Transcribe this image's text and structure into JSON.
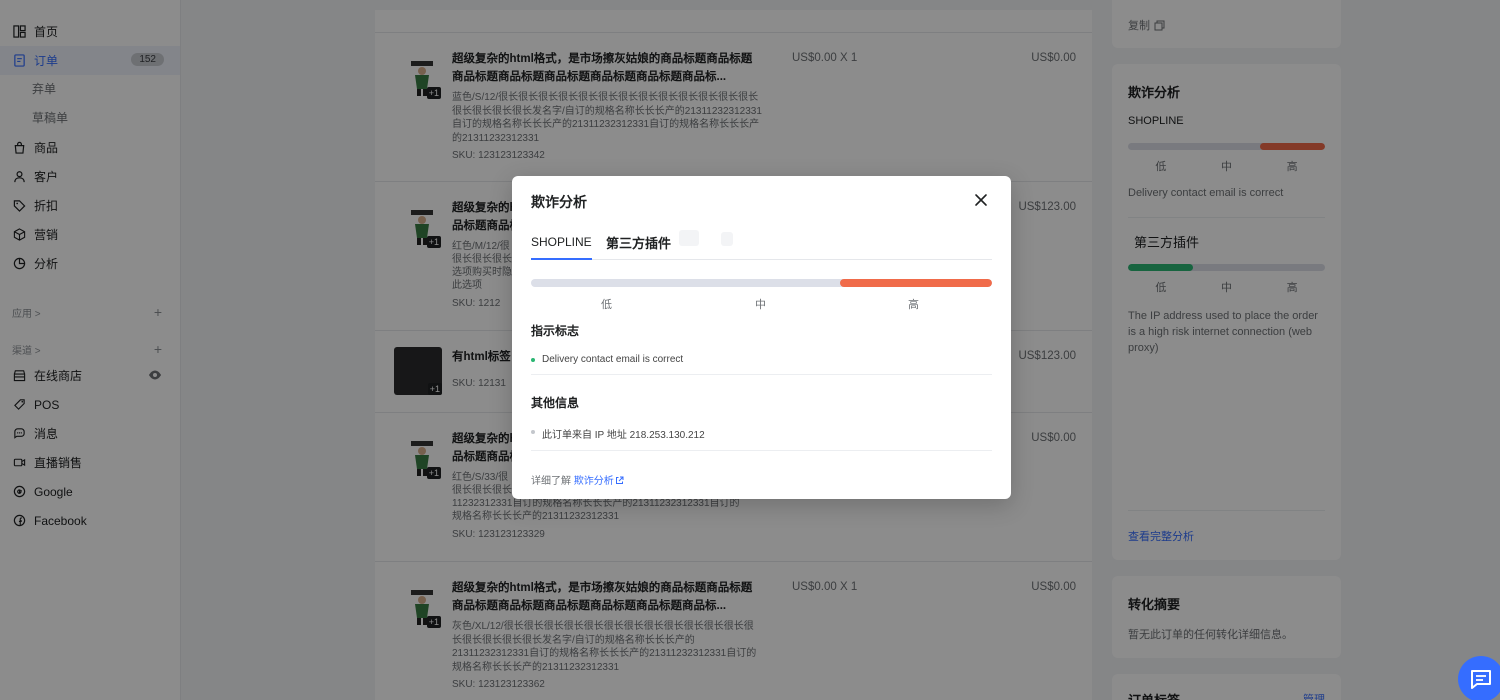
{
  "sidebar": {
    "items": [
      {
        "label": "首页",
        "icon": "home-icon"
      },
      {
        "label": "订单",
        "icon": "order-icon",
        "badge": "152",
        "active": true
      },
      {
        "label": "商品",
        "icon": "bag-icon"
      },
      {
        "label": "客户",
        "icon": "user-icon"
      },
      {
        "label": "折扣",
        "icon": "tag-icon"
      },
      {
        "label": "营销",
        "icon": "cube-icon"
      },
      {
        "label": "分析",
        "icon": "chart-icon"
      }
    ],
    "order_sub": [
      "弃单",
      "草稿单"
    ],
    "apps_section": "应用 >",
    "channels_section": "渠道 >",
    "channels": [
      {
        "label": "在线商店",
        "icon": "store-icon"
      },
      {
        "label": "POS",
        "icon": "pos-icon"
      },
      {
        "label": "消息",
        "icon": "message-icon"
      },
      {
        "label": "直播销售",
        "icon": "live-icon"
      },
      {
        "label": "Google",
        "icon": "google-icon"
      },
      {
        "label": "Facebook",
        "icon": "facebook-icon"
      }
    ],
    "plus": "+"
  },
  "products": [
    {
      "title": "超级复杂的html格式，是市场擦灰姑娘的商品标题商品标题商品标题商品标题商品标题商品标题商品标题商品标...",
      "variant": "蓝色/S/12/很长很长很长很长很长很长很长很长很长很长很长很长很长很长很长很长很长发名字/自订的规格名称长长长产的21311232312331自订的规格名称长长长产的21311232312331自订的规格名称长长长产的21311232312331",
      "sku": "SKU:  123123123342",
      "price": "US$0.00 X 1",
      "total": "US$0.00"
    },
    {
      "title": "超级复杂的h",
      "title2": "品标题商品标",
      "variant": "红色/M/12/很",
      "variant2": "很长很长很长",
      "variant3": "选项购买时隐",
      "variant4": "此选项",
      "sku": "SKU:  1212",
      "total": "US$123.00"
    },
    {
      "title": "有html标签",
      "sku": "SKU:  12131",
      "total": "US$123.00"
    },
    {
      "title": "超级复杂的h",
      "title2": "品标题商品标",
      "variant": "红色/S/33/很",
      "variant2": "很长很长很长",
      "variant3": "11232312331自订的规格名称长长长产的21311232312331自订的",
      "variant4": "规格名称长长长产的21311232312331",
      "sku": "SKU:  123123123329",
      "total": "US$0.00"
    },
    {
      "title": "超级复杂的html格式，是市场擦灰姑娘的商品标题商品标题商品标题商品标题商品标题商品标题商品标题商品标...",
      "variant": "灰色/XL/12/很长很长很长很长很长很长很长很长很长很长很长很长很长很长很长很长很长发名字/自订的规格名称长长长产的21311232312331自订的规格名称长长长产的21311232312331自订的规格名称长长长产的21311232312331",
      "sku": "SKU:  123123123362",
      "price": "US$0.00 X 1",
      "total": "US$0.00"
    }
  ],
  "plus_badge": "+1",
  "right": {
    "copy_label": "复制",
    "fraud": {
      "title": "欺诈分析",
      "shopline_label": "SHOPLINE",
      "shopline_level": 0.67,
      "levels": [
        "低",
        "中",
        "高"
      ],
      "shopline_note": "Delivery contact email is correct",
      "third_label": "第三方插件",
      "third_level": 0.33,
      "third_note": "The IP address used to place the order is a high risk internet connection (web proxy)",
      "link": "查看完整分析"
    },
    "conversion": {
      "title": "转化摘要",
      "text": "暂无此订单的任何转化详细信息。"
    },
    "tags": {
      "title": "订单标签",
      "manage": "管理"
    }
  },
  "modal": {
    "title": "欺诈分析",
    "tabs": [
      "SHOPLINE",
      "第三方插件"
    ],
    "risk_level": 0.67,
    "levels": [
      "低",
      "中",
      "高"
    ],
    "indicators_title": "指示标志",
    "indicator": "Delivery contact email is correct",
    "other_title": "其他信息",
    "other": "此订单来自 IP 地址 218.253.130.212",
    "footer_prefix": "详细了解 ",
    "footer_link": "欺诈分析",
    "colors": {
      "accent": "#356dff",
      "high": "#f06b4a",
      "low": "#2bb673",
      "dot_green": "#2bb673",
      "dot_gray": "#c4c7cc"
    }
  }
}
